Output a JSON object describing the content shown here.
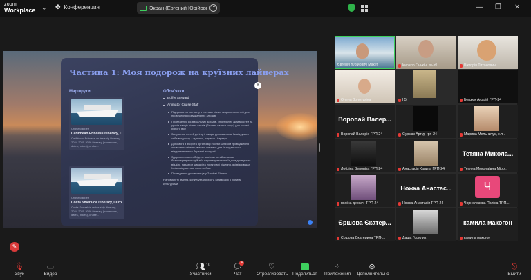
{
  "app": {
    "logo_line1": "zoom",
    "logo_line2": "Workplace",
    "conference_label": "Конференция",
    "screen_share_label": "Экран (Евгений Юрійович Маке"
  },
  "slide": {
    "title": "Частина 1: Моя подорож на круїзних лайнерах",
    "col_routes": "Маршрути",
    "col_duties": "Обов'язки",
    "routes": [
      {
        "source": "CruiseMapper",
        "title": "Caribbean Princess itinerary, Cu...",
        "desc": "Caribbean Princess cruise ship itinerary, 2024-2025-2026 itinerary (homeports, dates, prices), cruise..."
      },
      {
        "source": "CruiseMapper",
        "title": "Costa Smeralda itinerary, Curre...",
        "desc": "Costa Smeralda cruise ship itinerary, 2024-2025-2026 itinerary (homeports, dates, prices), cruise..."
      }
    ],
    "duties_top": [
      "Buffet Steward",
      "Animator Cruise Staff"
    ],
    "duties_sub": [
      "Підтримання контакту з гостями різних національностей для проведення розважальних заходів",
      "Проведення розважальних заходів, спортивних активностей та уроків танців різних стилів (бачата, сальса тощо) для гостей різного віку",
      "Залучення гостей до ігор і танців, допомагаючи їм відчувати себе в одному, з чужими, зокрема і бартери",
      "Допомога в зборі та організації гостей шляхом провадження оповіщень стільки уважно, вказівки для їх подальшого відправлення на береговi екскурсії",
      "Здорожнення необхідних заміток гостей шляхом безпосереднього дій або перенаправлення їх до відповідного відділу, надаючи швидкі та ефективні рішення, які відповідає їхнім очікуванням та потребам",
      "Проведення уроків танців у Zumba і Fitness"
    ],
    "footer": "Різноманітні вміння, конкуруючи роботу, взаємодію з різними культурами."
  },
  "participants": [
    {
      "name": "Євгенія Юрійович Макет",
      "muted": false,
      "active": true
    },
    {
      "name": "Кирило Гінькін, кв-ldl",
      "muted": true
    },
    {
      "name": "Вікторія Тихонович",
      "muted": true
    },
    {
      "name": "Олена Золотухіна",
      "muted": true
    },
    {
      "name": "І 5",
      "muted": true
    },
    {
      "name": "Бевзюк Андрій ГРП-24",
      "muted": true
    },
    {
      "name": "Воропай Валерія ГРП-24",
      "big": "Воропай Валер...",
      "muted": true
    },
    {
      "name": "Суржак Артур грп-24",
      "muted": true
    },
    {
      "name": "Марина Мельничук, к.л...",
      "muted": true
    },
    {
      "name": "Лобзіна Вероніка ГРП-24",
      "muted": true
    },
    {
      "name": "Анастасія Калита ГРП-24",
      "muted": true
    },
    {
      "name": "Тетяна Миколаївна Міро...",
      "big": "Тетяна Микола...",
      "muted": true
    },
    {
      "name": "поліна деркач- ГРП-24",
      "muted": true
    },
    {
      "name": "Ножка Анастасія ГРП-24",
      "big": "Ножка Анастас...",
      "muted": true
    },
    {
      "name": "Чорнолозова Поліна ТРП...",
      "muted": true,
      "avatar": "Ч"
    },
    {
      "name": "Єршова Єкатерина ТРП-...",
      "big": "Єршова Єкатер...",
      "muted": true
    },
    {
      "name": "Даша Горилик",
      "muted": true
    },
    {
      "name": "камила макогон",
      "big": "камила макогон",
      "muted": true
    }
  ],
  "toolbar": {
    "audio": "Звук",
    "video": "Видео",
    "participants": "Участники",
    "participants_count": "18",
    "chat": "Чат",
    "chat_badge": "4",
    "react": "Отреагировать",
    "share": "Поделиться",
    "apps": "Приложения",
    "more": "Дополнительно",
    "leave": "Выйти"
  },
  "colors": {
    "accent": "#3ecf5e",
    "muted_red": "#e53935",
    "slide_title": "#8a9ff0"
  }
}
